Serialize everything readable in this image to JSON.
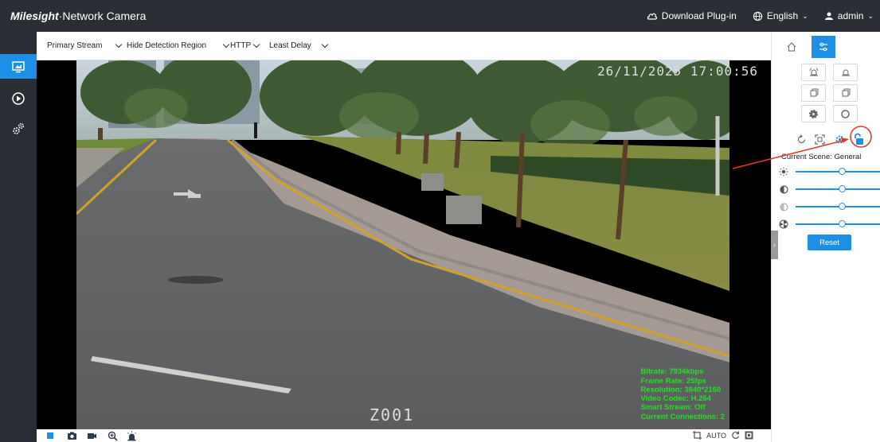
{
  "header": {
    "brand_logo": "Milesight",
    "brand_product": "·Network Camera",
    "download_label": "Download Plug-in",
    "language_label": "English",
    "user_label": "admin"
  },
  "toolbar": {
    "stream_label": "Primary Stream",
    "detection_label": "Hide Detection Region",
    "protocol_label": "HTTP",
    "delay_label": "Least Delay"
  },
  "leftnav": {
    "items": [
      {
        "name": "live-view",
        "icon": "monitor-icon",
        "active": true
      },
      {
        "name": "playback",
        "icon": "play-circle-icon",
        "active": false
      },
      {
        "name": "settings",
        "icon": "gears-icon",
        "active": false
      }
    ]
  },
  "video": {
    "timestamp": "26/11/2025 17:00:56",
    "camera_name": "Z001",
    "stats": {
      "bitrate": "Bitrate: 7934kbps",
      "frame_rate": "Frame Rate: 25fps",
      "resolution": "Resolution: 3840*2160",
      "codec": "Video Codec: H.264",
      "smart_stream": "Smart Stream: Off",
      "connections": "Current Connections: 2"
    }
  },
  "bottombar": {
    "auto_label": "AUTO"
  },
  "panel": {
    "scene_label": "Current Scene: General",
    "reset_label": "Reset",
    "sliders": [
      {
        "name": "brightness",
        "icon": "sun-icon",
        "value": 0.55
      },
      {
        "name": "contrast",
        "icon": "contrast-icon",
        "value": 0.55
      },
      {
        "name": "saturation",
        "icon": "saturation-icon",
        "value": 0.55
      },
      {
        "name": "sharpness",
        "icon": "sharpness-icon",
        "value": 0.55
      }
    ]
  },
  "colors": {
    "accent": "#1d8fe6",
    "header_bg": "#2b2f35",
    "stats_text": "#22e022",
    "annotation": "#e23a2e"
  }
}
